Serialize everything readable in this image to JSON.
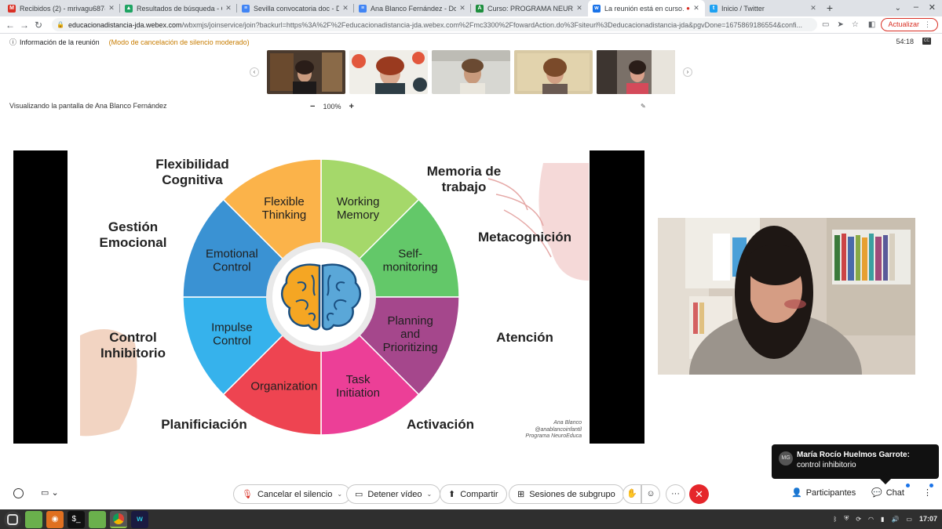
{
  "browser": {
    "tabs": [
      {
        "title": "Recibidos (2) - mrivagu687@g…",
        "favicon": "gmail-icon",
        "color": "#d93025",
        "active": false
      },
      {
        "title": "Resultados de búsqueda - Go…",
        "favicon": "drive-icon",
        "color": "#1fa463",
        "active": false
      },
      {
        "title": "Sevilla convocatoria doc - Doc…",
        "favicon": "docs-icon",
        "color": "#4285f4",
        "active": false
      },
      {
        "title": "Ana Blanco Fernández - Docu…",
        "favicon": "docs-icon",
        "color": "#4285f4",
        "active": false
      },
      {
        "title": "Curso: PROGRAMA NEUROED…",
        "favicon": "course-icon",
        "color": "#1e8e3e",
        "active": false
      },
      {
        "title": "La reunión está en curso…",
        "favicon": "webex-icon",
        "color": "#1a73e8",
        "active": true
      },
      {
        "title": "Inicio / Twitter",
        "favicon": "twitter-icon",
        "color": "#1da1f2",
        "active": false
      }
    ],
    "new_tab": "+",
    "url_domain": "educacionadistancia-jda.webex.com",
    "url_path": "/wbxmjs/joinservice/join?backurl=https%3A%2F%2Feducacionadistancia-jda.webex.com%2Fmc3300%2FfowardAction.do%3Fsiteurl%3Deducacionadistancia-jda&pgvDone=1675869186554&confi...",
    "update_label": "Actualizar"
  },
  "meeting": {
    "info_label": "Información de la reunión",
    "mode_label": "(Modo de cancelación de silencio moderado)",
    "elapsed": "54:18",
    "viewing_label": "Visualizando la pantalla de Ana Blanco Fernández",
    "zoom_minus": "−",
    "zoom_level": "100%",
    "zoom_plus": "+"
  },
  "slide": {
    "segments": [
      {
        "label": [
          "Working",
          "Memory"
        ],
        "color": "#a5d86a"
      },
      {
        "label": [
          "Self-",
          "monitoring"
        ],
        "color": "#63c869"
      },
      {
        "label": [
          "Planning",
          "and",
          "Prioritizing"
        ],
        "color": "#a5478c"
      },
      {
        "label": [
          "Task",
          "Initiation"
        ],
        "color": "#ec3f97"
      },
      {
        "label": [
          "Organization"
        ],
        "color": "#ee4451"
      },
      {
        "label": [
          "Impulse",
          "Control"
        ],
        "color": "#36b2ec"
      },
      {
        "label": [
          "Emotional",
          "Control"
        ],
        "color": "#3a92d3"
      },
      {
        "label": [
          "Flexible",
          "Thinking"
        ],
        "color": "#fbb34a"
      }
    ],
    "outer_labels": {
      "flexibilidad": "Flexibilidad\nCognitiva",
      "memoria": "Memoria de\ntrabajo",
      "gestion": "Gestión\nEmocional",
      "metacognicion": "Metacognición",
      "control": "Control\nInhibitorio",
      "atencion": "Atención",
      "planificacion": "Planificiación",
      "activacion": "Activación"
    },
    "credit": [
      "Ana Blanco",
      "@anablancoinfantil",
      "Programa NeuroEduca"
    ]
  },
  "chat_toast": {
    "avatar": "MG",
    "sender": "María Rocío Huelmos Garrote:",
    "message": " control inhibitorio"
  },
  "controls": {
    "mute_label": "Cancelar el silencio",
    "video_label": "Detener vídeo",
    "share_label": "Compartir",
    "breakout_label": "Sesiones de subgrupo",
    "participants_label": "Participantes",
    "chat_label": "Chat",
    "more_label": "···"
  },
  "taskbar": {
    "clock": "17:07"
  }
}
